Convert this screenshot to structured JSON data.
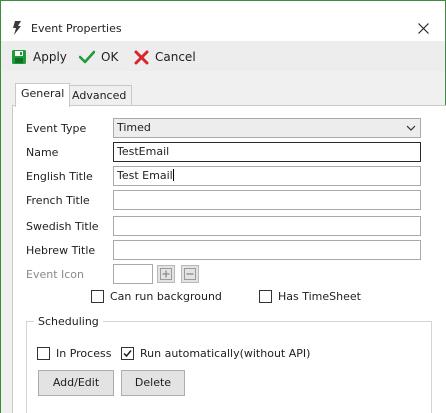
{
  "window": {
    "title": "Event Properties"
  },
  "toolbar": {
    "apply_label": "Apply",
    "ok_label": "OK",
    "cancel_label": "Cancel"
  },
  "tabs": [
    {
      "label": "General"
    },
    {
      "label": "Advanced"
    }
  ],
  "form": {
    "event_type": {
      "label": "Event Type",
      "value": "Timed"
    },
    "name": {
      "label": "Name",
      "value": "TestEmail"
    },
    "english_title": {
      "label": "English Title",
      "value": "Test Email"
    },
    "french_title": {
      "label": "French Title",
      "value": ""
    },
    "swedish_title": {
      "label": "Swedish Title",
      "value": ""
    },
    "hebrew_title": {
      "label": "Hebrew Title",
      "value": ""
    },
    "event_icon": {
      "label": "Event Icon"
    },
    "can_run_background": {
      "label": "Can run background",
      "checked": false
    },
    "has_timesheet": {
      "label": "Has TimeSheet",
      "checked": false
    }
  },
  "scheduling": {
    "title": "Scheduling",
    "in_process": {
      "label": "In Process",
      "checked": false
    },
    "run_automatically": {
      "label": "Run automatically(without API)",
      "checked": true
    },
    "add_edit_label": "Add/Edit",
    "delete_label": "Delete"
  },
  "colors": {
    "accent_green": "#1f9b3a",
    "cancel_red": "#d9242b",
    "window_border": "#3c8c3c"
  }
}
